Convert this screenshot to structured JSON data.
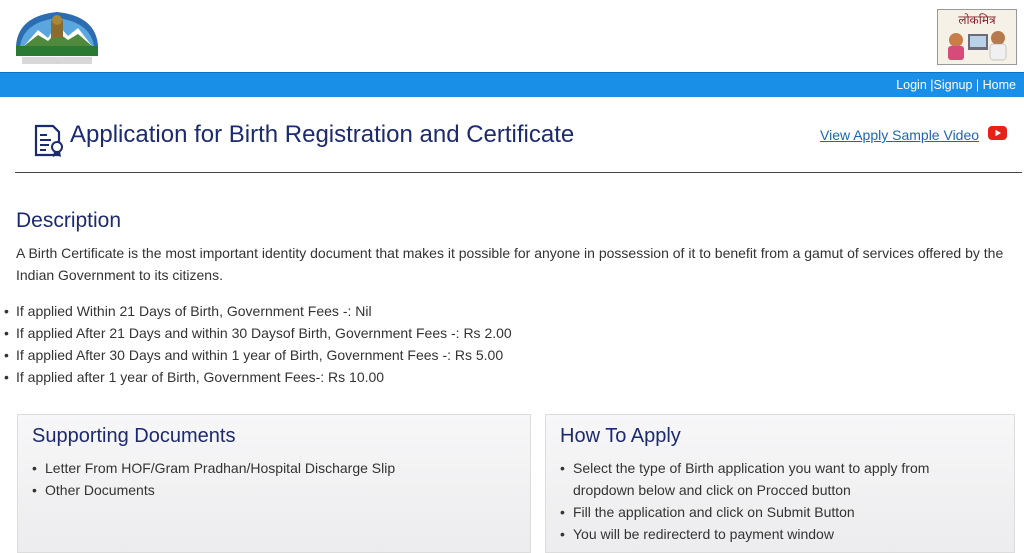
{
  "header": {
    "logo_left": "himachal-pradesh-emblem-logo",
    "logo_right": "lok-mitra-logo",
    "logo_right_text": "लोकमित्र"
  },
  "nav": {
    "login": "Login",
    "signup": "Signup",
    "home": "Home",
    "sep1": " |",
    "sep2": " | "
  },
  "title": {
    "text": "Application for Birth Registration and Certificate",
    "icon": "document-certificate-icon",
    "video_link": "View Apply Sample Video",
    "video_icon": "youtube-icon"
  },
  "description": {
    "heading": "Description",
    "text": "A Birth Certificate is the most important identity document that makes it possible for anyone in possession of it to benefit from a gamut of services offered by the Indian Government to its citizens.",
    "fees": [
      "If applied Within 21 Days of Birth, Government Fees -: Nil",
      "If applied After 21 Days and within 30 Daysof Birth, Government Fees -: Rs 2.00",
      "If applied After 30 Days and within 1 year of Birth, Government Fees -: Rs 5.00",
      "If applied after 1 year of Birth, Government Fees-: Rs 10.00"
    ]
  },
  "supporting_documents": {
    "heading": "Supporting Documents",
    "items": [
      "Letter From HOF/Gram Pradhan/Hospital Discharge Slip",
      "Other Documents"
    ]
  },
  "how_to_apply": {
    "heading": "How To Apply",
    "items": [
      "Select the type of Birth application you want to apply from dropdown below and click on Procced button",
      "Fill the application and click on Submit Button",
      "You will be redirecterd to payment window"
    ]
  },
  "colors": {
    "navbar": "#1a8fe8",
    "heading": "#1c2a70",
    "link": "#1a67b8",
    "youtube": "#e62117"
  }
}
